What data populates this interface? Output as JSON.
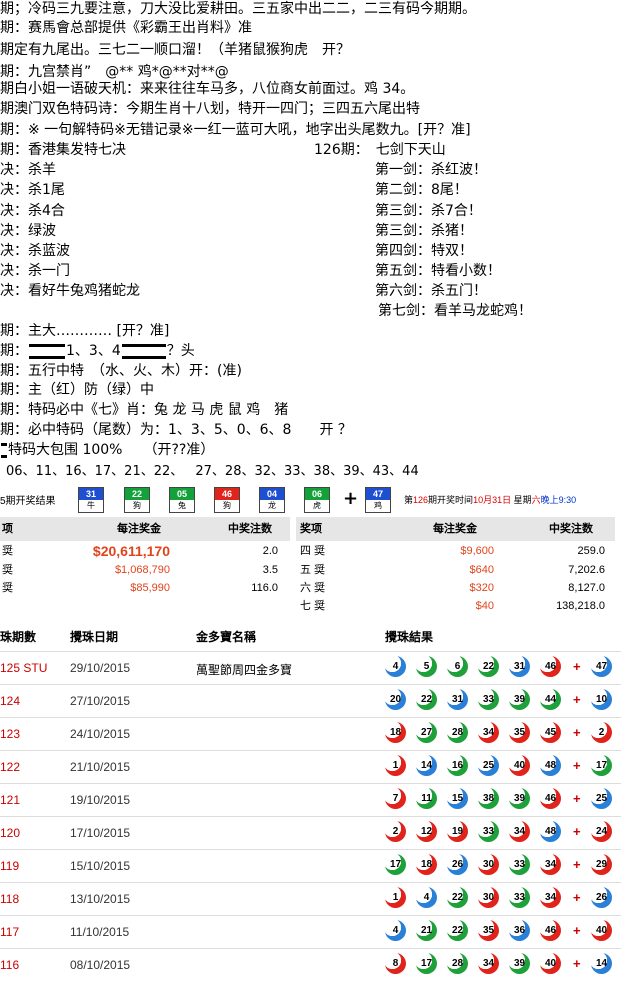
{
  "lines": {
    "l1": "期；冷码三九要注意，刀大没比爱耕田。三五家中出二二，二三有码今期期。",
    "l2": "期：赛馬會总部提供《彩霸王出肖料》准",
    "l3": "期定有九尾出。三七二一顺口溜！（羊猪鼠猴狗虎　开？",
    "l4": "期：九宫禁肖”　@** 鸡*@**对**@",
    "l5": "期白小姐一语破天机：来来往往车马多，八位商女前面过。鸡 34。",
    "l6": "期澳门双色特码诗：今期生肖十八划，特开一四门；三四五六尾出特",
    "l7": "期：※ 一句解特码※无错记录※一红一蓝可大吼，地字出头尾数九。[开？准]",
    "l8": "期：香港集发特七决",
    "l8b": "126期：　七剑下天山",
    "jue": [
      "决：杀羊",
      "决：杀1尾",
      "决：杀4合",
      "决：绿波",
      "决：杀蓝波",
      "决：杀一门",
      "决：看好牛兔鸡猪蛇龙"
    ],
    "jian": [
      "第一剑：杀红波！",
      "第二剑：8尾！",
      "第三剑：杀7合！",
      "第三剑：杀猪！",
      "第四剑：特双！",
      "第五剑：特看小数！",
      "第六剑：杀五门！",
      "第七剑：看羊马龙蛇鸡！"
    ],
    "l9": "期：主大………… [开？准]",
    "l10a": "期：",
    "l10b": "1、3、4",
    "l10c": "？头",
    "l11": "期：五行中特　（水、火、木）开：(准)",
    "l12": "期：主（红）防（绿）中",
    "l13": "期：特码必中《七》肖：兔 龙 马 虎 鼠 鸡　猪",
    "l14": "期：必中特码（尾数）为：1、3、5、0、6、8　　开 ？",
    "l15": "特码大包围 100%　　（开??准）",
    "l16": "06、11、16、17、21、22、 27、28、32、33、38、39、43、44"
  },
  "draw": {
    "label": "5期开奖结果",
    "balls": [
      {
        "num": "31",
        "zodiac": "牛",
        "color": "#1f4fd1"
      },
      {
        "num": "22",
        "zodiac": "狗",
        "color": "#13a13a"
      },
      {
        "num": "05",
        "zodiac": "兔",
        "color": "#13a13a"
      },
      {
        "num": "46",
        "zodiac": "狗",
        "color": "#e0241c"
      },
      {
        "num": "04",
        "zodiac": "龙",
        "color": "#1f4fd1"
      },
      {
        "num": "06",
        "zodiac": "虎",
        "color": "#13a13a"
      }
    ],
    "plus": "+",
    "special": {
      "num": "47",
      "zodiac": "鸡",
      "color": "#1f4fd1"
    },
    "next_prefix": "第",
    "next_no": "126",
    "next_mid": "期开奖时间",
    "next_date": "10月31日",
    "next_week": " 星期",
    "next_day": "六",
    "next_time": "晚上9:30"
  },
  "prizes": {
    "h_item": "项",
    "h_amount": "每注奖金",
    "h_winners": "中奖注数",
    "h_item2": "奖项",
    "h_amount2": "每注奖金",
    "h_winners2": "中奖注数",
    "left": [
      {
        "name": "奨",
        "amount": "$20,611,170",
        "winners": "2.0"
      },
      {
        "name": "奨",
        "amount": "$1,068,790",
        "winners": "3.5"
      },
      {
        "name": "奨",
        "amount": "$85,990",
        "winners": "116.0"
      }
    ],
    "right": [
      {
        "name": "四 奨",
        "amount": "$9,600",
        "winners": "259.0"
      },
      {
        "name": "五 奨",
        "amount": "$640",
        "winners": "7,202.6"
      },
      {
        "name": "六 奨",
        "amount": "$320",
        "winners": "8,127.0"
      },
      {
        "name": "七 奨",
        "amount": "$40",
        "winners": "138,218.0"
      }
    ]
  },
  "history": {
    "h_draw": "珠期數",
    "h_date": "攪珠日期",
    "h_name": "金多寶名稱",
    "h_result": "攪珠結果",
    "colors": {
      "red": "#e0241c",
      "blue": "#2a7fd6",
      "green": "#1ea13a"
    },
    "rows": [
      {
        "draw": "125 STU",
        "date": "29/10/2015",
        "name": "萬聖節周四金多寶",
        "nums": [
          [
            "4",
            "b"
          ],
          [
            "5",
            "g"
          ],
          [
            "6",
            "g"
          ],
          [
            "22",
            "g"
          ],
          [
            "31",
            "b"
          ],
          [
            "46",
            "r"
          ]
        ],
        "special": [
          "47",
          "b"
        ]
      },
      {
        "draw": "124",
        "date": "27/10/2015",
        "name": "",
        "nums": [
          [
            "20",
            "b"
          ],
          [
            "22",
            "g"
          ],
          [
            "31",
            "b"
          ],
          [
            "33",
            "g"
          ],
          [
            "39",
            "g"
          ],
          [
            "44",
            "g"
          ]
        ],
        "special": [
          "10",
          "b"
        ]
      },
      {
        "draw": "123",
        "date": "24/10/2015",
        "name": "",
        "nums": [
          [
            "18",
            "r"
          ],
          [
            "27",
            "g"
          ],
          [
            "28",
            "g"
          ],
          [
            "34",
            "r"
          ],
          [
            "35",
            "r"
          ],
          [
            "45",
            "r"
          ]
        ],
        "special": [
          "2",
          "r"
        ]
      },
      {
        "draw": "122",
        "date": "21/10/2015",
        "name": "",
        "nums": [
          [
            "1",
            "r"
          ],
          [
            "14",
            "b"
          ],
          [
            "16",
            "g"
          ],
          [
            "25",
            "b"
          ],
          [
            "40",
            "r"
          ],
          [
            "48",
            "b"
          ]
        ],
        "special": [
          "17",
          "g"
        ]
      },
      {
        "draw": "121",
        "date": "19/10/2015",
        "name": "",
        "nums": [
          [
            "7",
            "r"
          ],
          [
            "11",
            "g"
          ],
          [
            "15",
            "b"
          ],
          [
            "38",
            "g"
          ],
          [
            "39",
            "g"
          ],
          [
            "46",
            "r"
          ]
        ],
        "special": [
          "25",
          "b"
        ]
      },
      {
        "draw": "120",
        "date": "17/10/2015",
        "name": "",
        "nums": [
          [
            "2",
            "r"
          ],
          [
            "12",
            "r"
          ],
          [
            "19",
            "r"
          ],
          [
            "33",
            "g"
          ],
          [
            "34",
            "r"
          ],
          [
            "48",
            "b"
          ]
        ],
        "special": [
          "24",
          "r"
        ]
      },
      {
        "draw": "119",
        "date": "15/10/2015",
        "name": "",
        "nums": [
          [
            "17",
            "g"
          ],
          [
            "18",
            "r"
          ],
          [
            "26",
            "b"
          ],
          [
            "30",
            "r"
          ],
          [
            "33",
            "g"
          ],
          [
            "34",
            "r"
          ]
        ],
        "special": [
          "29",
          "r"
        ]
      },
      {
        "draw": "118",
        "date": "13/10/2015",
        "name": "",
        "nums": [
          [
            "1",
            "r"
          ],
          [
            "4",
            "b"
          ],
          [
            "22",
            "g"
          ],
          [
            "30",
            "r"
          ],
          [
            "33",
            "g"
          ],
          [
            "34",
            "r"
          ]
        ],
        "special": [
          "26",
          "b"
        ]
      },
      {
        "draw": "117",
        "date": "11/10/2015",
        "name": "",
        "nums": [
          [
            "4",
            "b"
          ],
          [
            "21",
            "g"
          ],
          [
            "22",
            "g"
          ],
          [
            "35",
            "r"
          ],
          [
            "36",
            "b"
          ],
          [
            "46",
            "r"
          ]
        ],
        "special": [
          "40",
          "r"
        ]
      },
      {
        "draw": "116",
        "date": "08/10/2015",
        "name": "",
        "nums": [
          [
            "8",
            "r"
          ],
          [
            "17",
            "g"
          ],
          [
            "28",
            "g"
          ],
          [
            "34",
            "r"
          ],
          [
            "39",
            "g"
          ],
          [
            "40",
            "r"
          ]
        ],
        "special": [
          "14",
          "b"
        ]
      }
    ]
  }
}
